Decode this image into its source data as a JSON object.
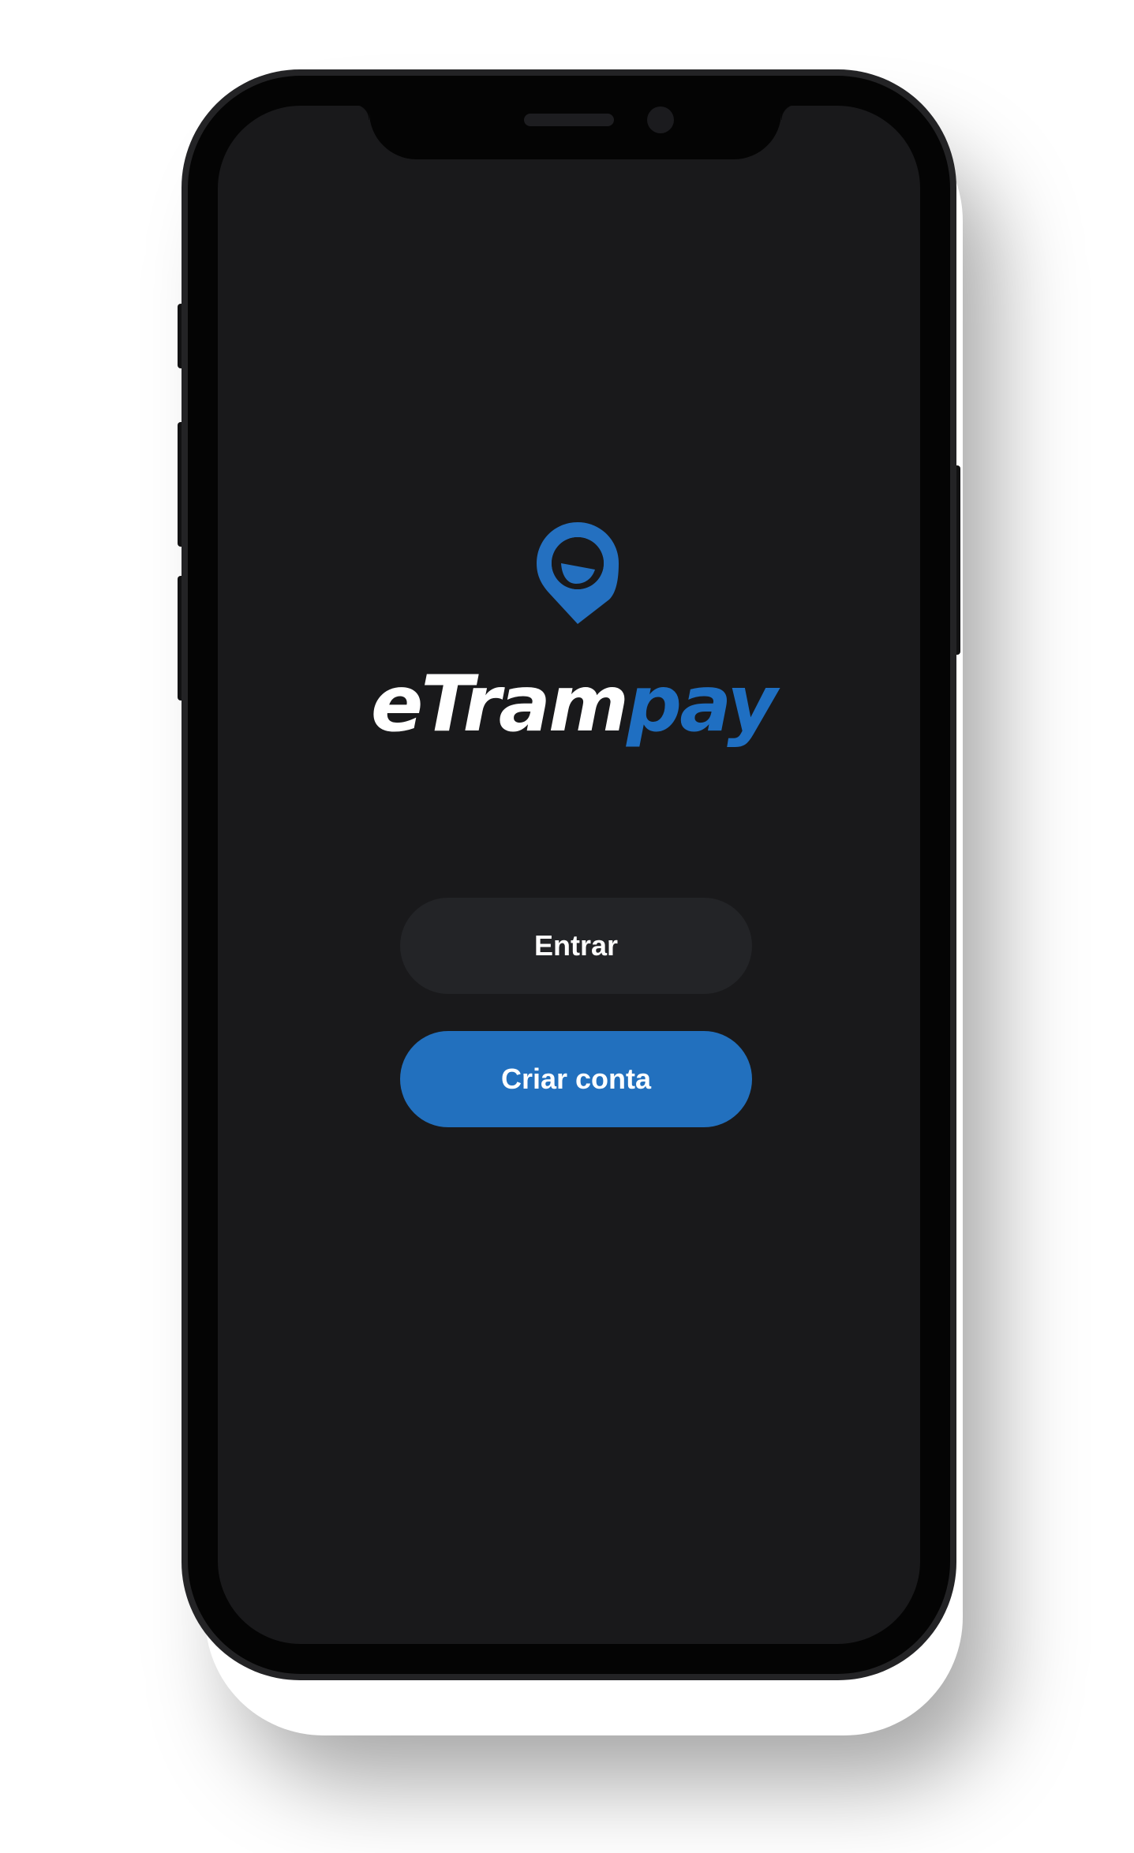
{
  "brand": {
    "name_part1": "eTram",
    "name_part2": "pay",
    "accent_color": "#1f6fc2",
    "logo_icon": "location-pin-smile-icon"
  },
  "actions": {
    "login_label": "Entrar",
    "signup_label": "Criar conta"
  },
  "colors": {
    "screen_background": "#19191b",
    "login_button": "#232427",
    "signup_button": "#2270be"
  }
}
